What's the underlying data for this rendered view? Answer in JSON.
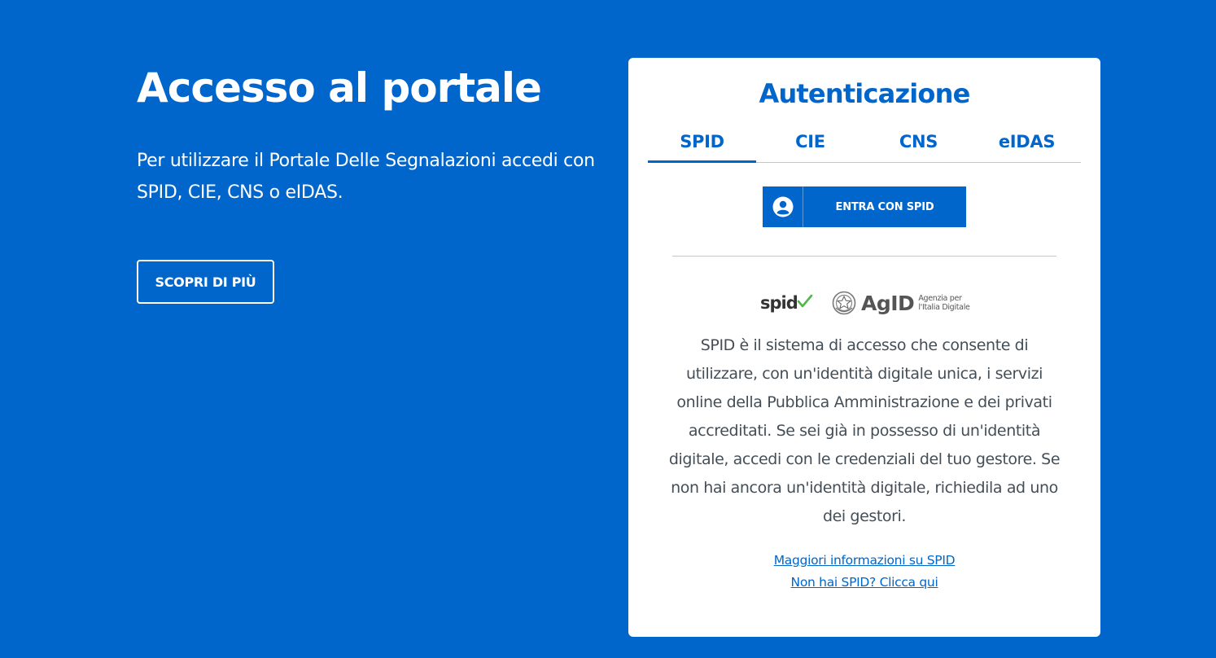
{
  "intro": {
    "title": "Accesso al portale",
    "description": "Per utilizzare il Portale Delle Segnalazioni accedi con SPID, CIE, CNS o eIDAS.",
    "discover_button": "SCOPRI DI PIÙ"
  },
  "auth": {
    "title": "Autenticazione",
    "tabs": [
      {
        "label": "SPID",
        "active": true
      },
      {
        "label": "CIE",
        "active": false
      },
      {
        "label": "CNS",
        "active": false
      },
      {
        "label": "eIDAS",
        "active": false
      }
    ],
    "spid_button": "ENTRA CON SPID",
    "logos": {
      "spid": "spid",
      "agid": "AgID",
      "agid_full_name": "Agenzia per l'Italia Digitale"
    },
    "description": "SPID è il sistema di accesso che consente di utilizzare, con un'identità digitale unica, i servizi online della Pubblica Amministrazione e dei privati accreditati. Se sei già in possesso di un'identità digitale, accedi con le credenziali del tuo gestore. Se non hai ancora un'identità digitale, richiedila ad uno dei gestori.",
    "links": [
      "Maggiori informazioni su SPID",
      "Non hai SPID? Clicca qui"
    ]
  },
  "colors": {
    "background": "#0066cc",
    "accent": "#0066cc",
    "card": "#ffffff",
    "text": "#444e57",
    "spid_check": "#4fb848"
  }
}
